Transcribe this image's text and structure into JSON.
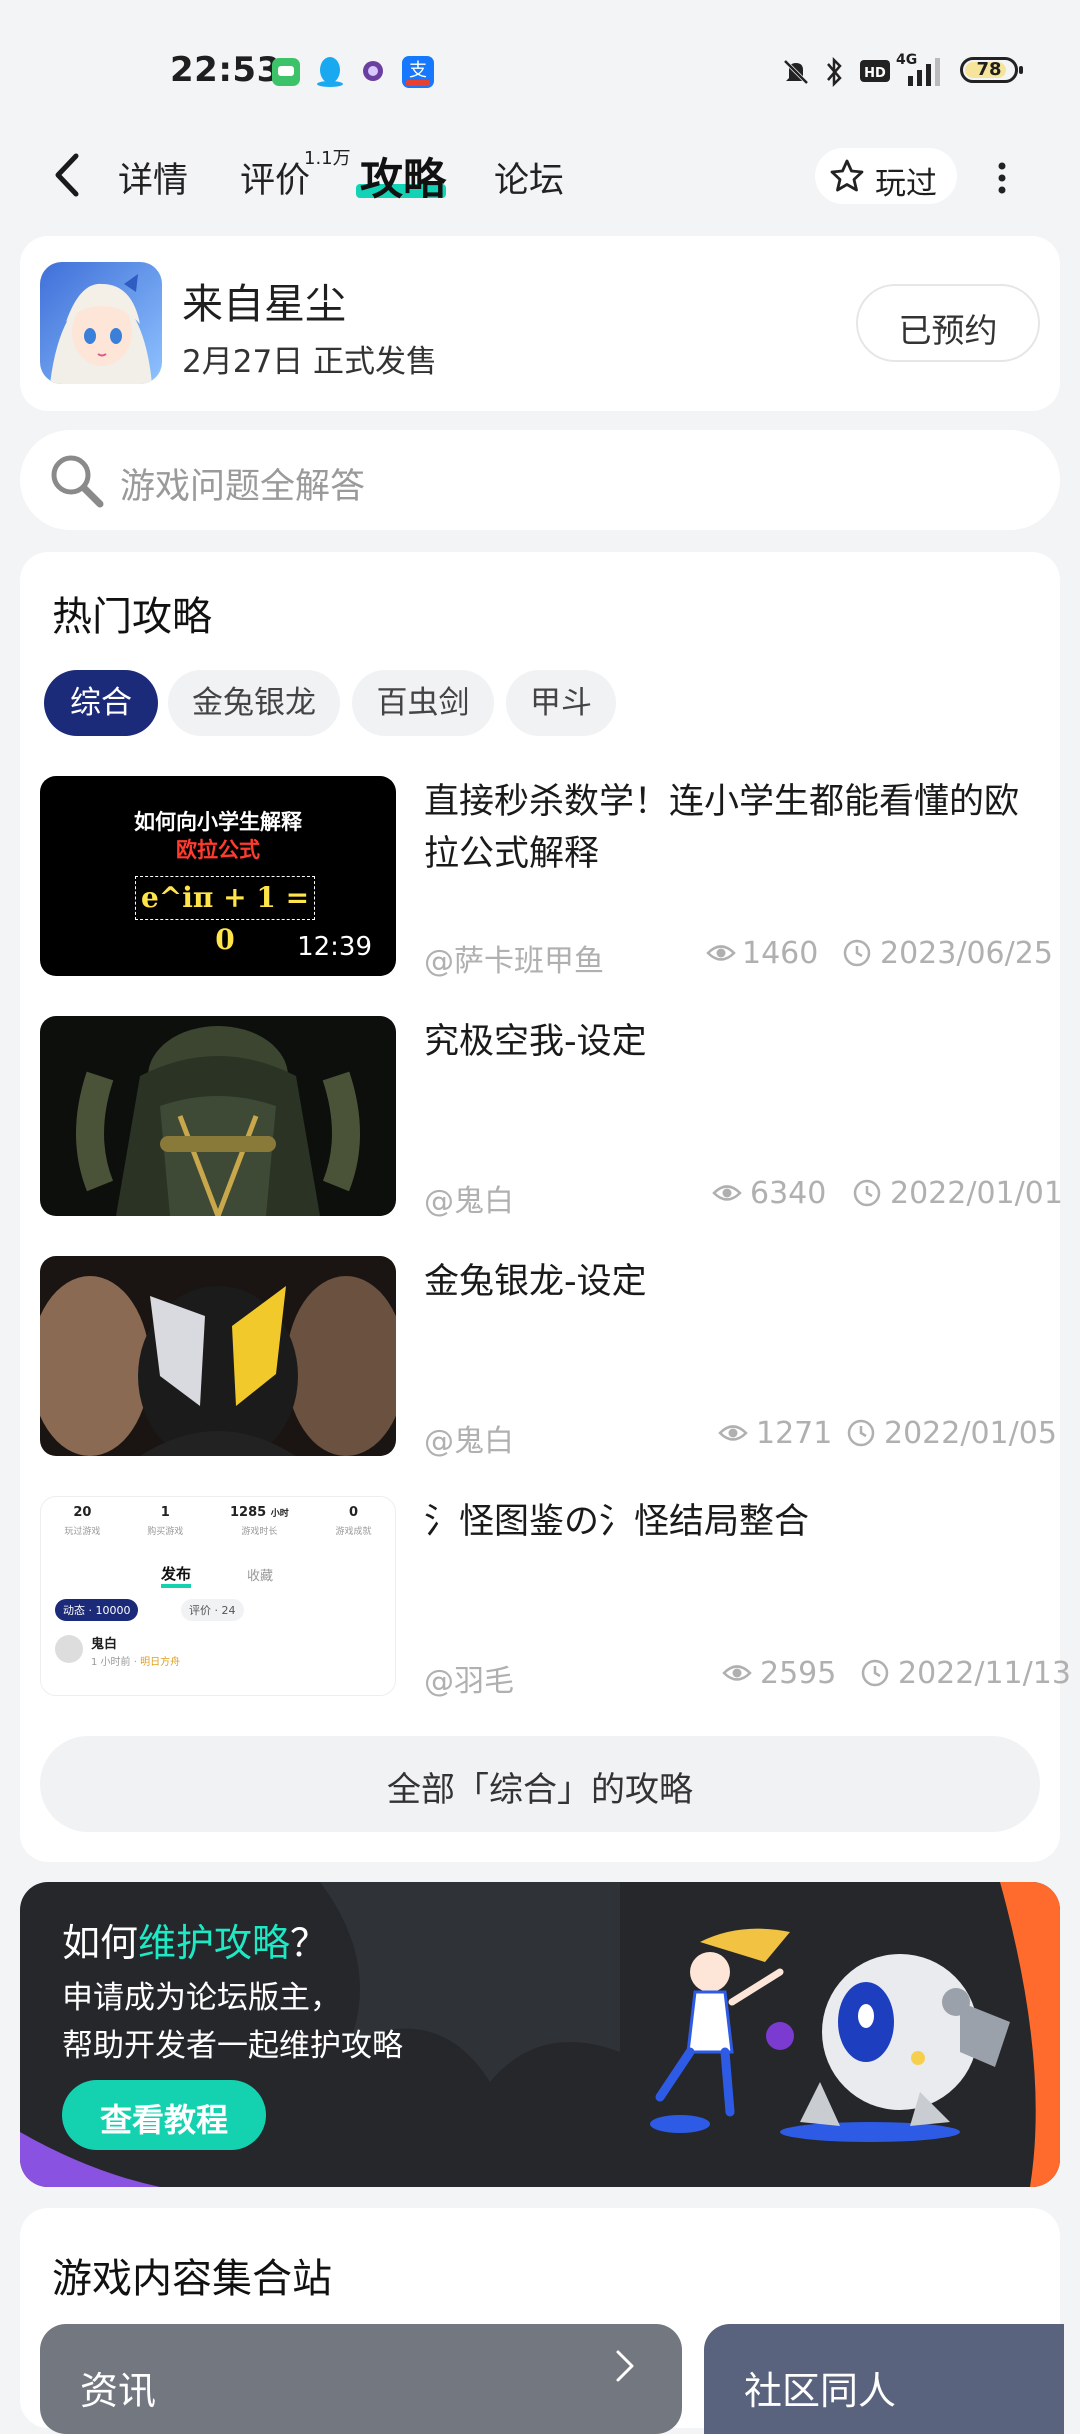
{
  "status_bar": {
    "time": "22:53",
    "battery": "78",
    "network": "4G"
  },
  "nav": {
    "tabs": [
      {
        "label": "详情"
      },
      {
        "label": "评价",
        "count": "1.1万"
      },
      {
        "label": "攻略"
      },
      {
        "label": "论坛"
      }
    ],
    "played_label": "玩过"
  },
  "game": {
    "title": "来自星尘",
    "release": "2月27日 正式发售",
    "reserve_label": "已预约"
  },
  "search": {
    "placeholder": "游戏问题全解答"
  },
  "hot_guides": {
    "title": "热门攻略",
    "filters": [
      "综合",
      "金兔银龙",
      "百虫剑",
      "甲斗"
    ],
    "items": [
      {
        "title": "直接秒杀数学！连小学生都能看懂的欧拉公式解释",
        "author": "@萨卡班甲鱼",
        "views": "1460",
        "date": "2023/06/25",
        "thumb": {
          "line1": "如何向小学生解释",
          "line2": "欧拉公式",
          "formula": "e^iπ + 1 = 0",
          "duration": "12:39"
        }
      },
      {
        "title": "究极空我-设定",
        "author": "@鬼白",
        "views": "6340",
        "date": "2022/01/01"
      },
      {
        "title": "金兔银龙-设定",
        "author": "@鬼白",
        "views": "1271",
        "date": "2022/01/05"
      },
      {
        "title": "氵怪图鉴の氵怪结局整合",
        "author": "@羽毛",
        "views": "2595",
        "date": "2022/11/13",
        "thumb": {
          "stats": [
            "20",
            "1",
            "1285",
            "0"
          ],
          "stat_unit": "小时",
          "stat_labels": [
            "玩过游戏",
            "购买游戏",
            "游戏时长",
            "游戏成就"
          ],
          "tabs": [
            "发布",
            "收藏"
          ],
          "badge1": "动态 · 10000",
          "badge2": "评价 · 24",
          "user": "鬼白",
          "meta": "1 小时前 · ",
          "meta_link": "明日方舟"
        }
      }
    ],
    "all_label": "全部「综合」的攻略"
  },
  "banner": {
    "title_prefix": "如何",
    "title_accent": "维护攻略",
    "title_suffix": "？",
    "line1": "申请成为论坛版主，",
    "line2": "帮助开发者一起维护攻略",
    "button": "查看教程"
  },
  "collection": {
    "title": "游戏内容集合站",
    "tiles": [
      "资讯",
      "社区同人"
    ]
  }
}
